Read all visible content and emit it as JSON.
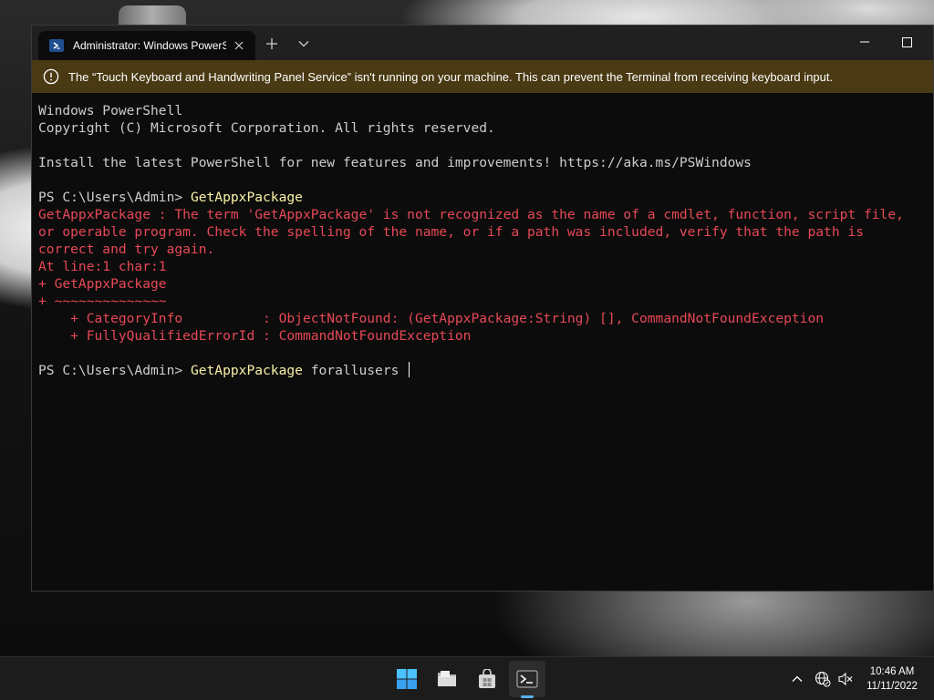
{
  "window": {
    "tab_title": "Administrator: Windows PowerShell"
  },
  "infobar": {
    "message": "The “Touch Keyboard and Handwriting Panel Service” isn't running on your machine. This can prevent the Terminal from receiving keyboard input."
  },
  "console": {
    "lines": [
      {
        "text": "Windows PowerShell",
        "style": "normal"
      },
      {
        "text": "Copyright (C) Microsoft Corporation. All rights reserved.",
        "style": "normal"
      },
      {
        "text": "",
        "style": "normal"
      },
      {
        "text": "Install the latest PowerShell for new features and improvements! https://aka.ms/PSWindows",
        "style": "normal"
      },
      {
        "text": "",
        "style": "normal"
      },
      {
        "prompt": "PS C:\\Users\\Admin> ",
        "command": "GetAppxPackage",
        "args": "",
        "style": "prompt"
      },
      {
        "text": "GetAppxPackage : The term 'GetAppxPackage' is not recognized as the name of a cmdlet, function, script file,",
        "style": "error"
      },
      {
        "text": "or operable program. Check the spelling of the name, or if a path was included, verify that the path is",
        "style": "error"
      },
      {
        "text": "correct and try again.",
        "style": "error"
      },
      {
        "text": "At line:1 char:1",
        "style": "error"
      },
      {
        "text": "+ GetAppxPackage",
        "style": "error"
      },
      {
        "text": "+ ~~~~~~~~~~~~~~",
        "style": "error"
      },
      {
        "text": "    + CategoryInfo          : ObjectNotFound: (GetAppxPackage:String) [], CommandNotFoundException",
        "style": "error"
      },
      {
        "text": "    + FullyQualifiedErrorId : CommandNotFoundException",
        "style": "error"
      },
      {
        "text": "",
        "style": "normal"
      },
      {
        "prompt": "PS C:\\Users\\Admin> ",
        "command": "GetAppxPackage",
        "args": " forallusers ",
        "style": "prompt",
        "cursor": true
      }
    ]
  },
  "taskbar": {
    "apps": [
      {
        "name": "start",
        "icon": "windows-logo-icon"
      },
      {
        "name": "file-explorer",
        "icon": "folder-icon"
      },
      {
        "name": "microsoft-store",
        "icon": "store-bag-icon"
      },
      {
        "name": "terminal",
        "icon": "terminal-icon",
        "active": true
      }
    ],
    "time": "10:46 AM",
    "date": "11/11/2022"
  },
  "colors": {
    "console_bg": "#0c0c0c",
    "console_text": "#cccccc",
    "error_text": "#e74856",
    "command_text": "#f9f1a5",
    "infobar_bg": "#4a3a13",
    "accent": "#58b0f0"
  }
}
